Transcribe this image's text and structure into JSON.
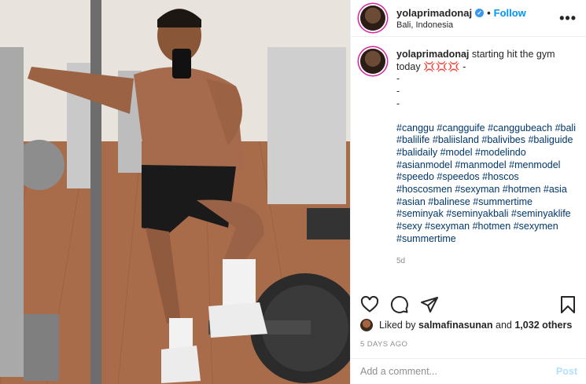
{
  "post": {
    "username": "yolaprimadonaj",
    "location": "Bali, Indonesia",
    "follow_label": "Follow",
    "dot": "•",
    "more_label": "•••",
    "caption_text": "starting hit the gym today 💢💢💢 -",
    "caption_dashes": [
      "-",
      "-",
      "-"
    ],
    "hashtags": "#canggu #cangguife #canggubeach #bali #balilife #baliisland #balivibes #baliguide #balidaily #model #modelindo #asianmodel #manmodel #menmodel #speedo #speedos #hoscos #hoscosmen #sexyman #hotmen #asia #asian #balinese #summertime #seminyak #seminyakbali #seminyaklife #sexy #sexyman #hotmen #sexymen #summertime",
    "caption_age": "5d",
    "liked_by_prefix": "Liked by",
    "liked_by_user": "salmafinasunan",
    "liked_by_and": "and",
    "liked_by_count": "1,032 others",
    "days_ago": "5 DAYS AGO",
    "comment_placeholder": "Add a comment...",
    "post_label": "Post"
  },
  "icons": [
    "verified-badge-icon",
    "heart-icon",
    "comment-icon",
    "share-icon",
    "bookmark-icon",
    "more-options-icon"
  ],
  "colors": {
    "link": "#0095f6",
    "hashtag": "#00376b",
    "muted": "#8e8e8e",
    "post_disabled": "#b2dffc"
  }
}
